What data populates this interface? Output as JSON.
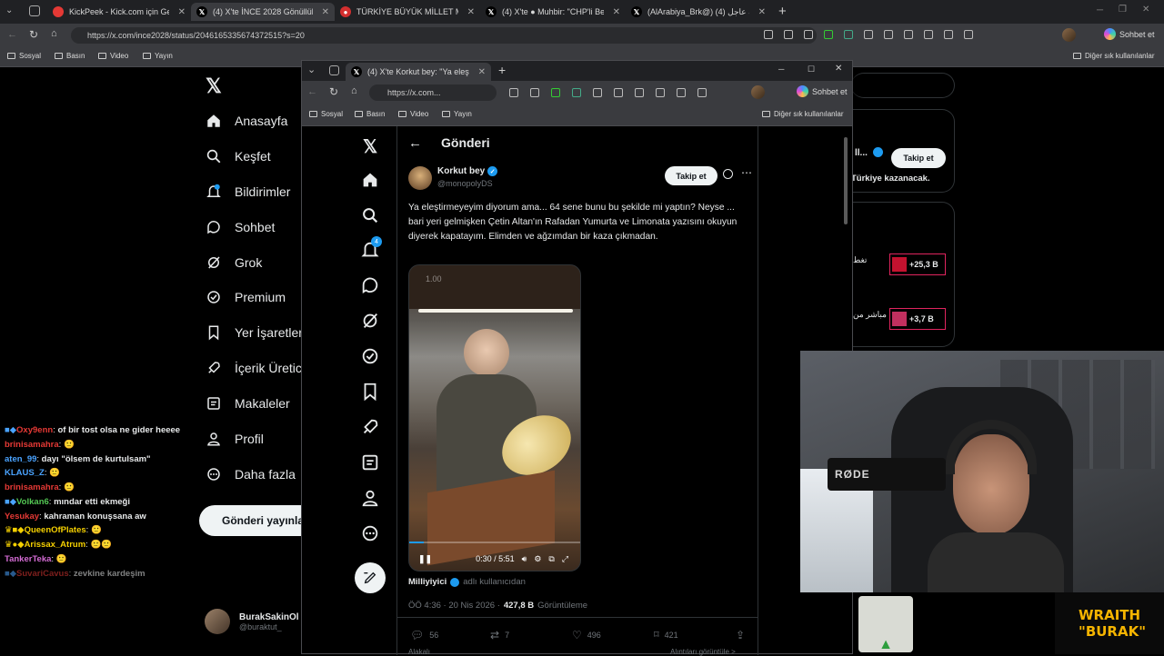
{
  "tabs": [
    {
      "label": "KickPeek - Kick.com için Gerçek Za",
      "fav_color": "#e53935"
    },
    {
      "label": "(4) X'te İNCE 2028 Gönüllüleri: \"Al",
      "fav_color": "#000000"
    },
    {
      "label": "TÜRKİYE BÜYÜK MİLLET MECLİSİ",
      "fav_color": "#d32f2f"
    },
    {
      "label": "(4) X'te ● Muhbir: \"CHP'li Belediy",
      "fav_color": "#000000"
    },
    {
      "label": "(AlArabiya_Brk@) العربية عاجل (4)",
      "fav_color": "#000000"
    }
  ],
  "back_browser": {
    "url": "https://x.com/ince2028/status/2046165335674372515?s=20",
    "profile_button": "Sohbet et",
    "bookmarks": [
      "Sosyal",
      "Basın",
      "Video",
      "Yayın"
    ],
    "other_bookmarks": "Diğer sık kullanılanlar"
  },
  "back_nav": [
    {
      "label": "Anasayfa",
      "icon": "home-icon"
    },
    {
      "label": "Keşfet",
      "icon": "search-icon"
    },
    {
      "label": "Bildirimler",
      "icon": "bell-icon"
    },
    {
      "label": "Sohbet",
      "icon": "chat-icon"
    },
    {
      "label": "Grok",
      "icon": "grok-icon"
    },
    {
      "label": "Premium",
      "icon": "premium-icon"
    },
    {
      "label": "Yer İşaretleri",
      "icon": "bookmark-icon"
    },
    {
      "label": "İçerik Üretici",
      "icon": "rocket-icon"
    },
    {
      "label": "Makaleler",
      "icon": "article-icon"
    },
    {
      "label": "Profil",
      "icon": "person-icon"
    },
    {
      "label": "Daha fazla",
      "icon": "more-icon"
    }
  ],
  "back_post_button": "Gönderi yayınla",
  "back_notification_badge": "4",
  "back_profile": {
    "name": "BurakSakinOl",
    "handle": "@buraktut_"
  },
  "back_right": {
    "follow_label": "Takip et",
    "name_fragment": "ll...",
    "text": "Türkiye kazanacak.",
    "trend1_value": "+25,3 B",
    "trend1_text": "تغط",
    "trend2_value": "+3,7 B",
    "trend2_text": "مباشر من"
  },
  "chat": [
    {
      "name": "Oxy9enn",
      "name_color": "#e53935",
      "msg": "of bir tost olsa ne gider heeee"
    },
    {
      "name": "brinisamahra",
      "name_color": "#e53935",
      "msg": "🙂"
    },
    {
      "name": "aten_99",
      "name_color": "#4aa3ff",
      "msg": "dayı \"ölsem de kurtulsam\""
    },
    {
      "name": "KLAUS_Z",
      "name_color": "#4aa3ff",
      "msg": "🙂"
    },
    {
      "name": "brinisamahra",
      "name_color": "#e53935",
      "msg": "🙂"
    },
    {
      "name": "Volkan6",
      "name_color": "#53c653",
      "msg": "mındar etti ekmeği"
    },
    {
      "name": "Yesukay",
      "name_color": "#e53935",
      "msg": "kahraman konuşsana aw"
    },
    {
      "name": "QueenOfPlates",
      "name_color": "#f5d000",
      "msg": "🙂"
    },
    {
      "name": "Arissax_Atrum",
      "name_color": "#f5d000",
      "msg": "🙂🙂"
    },
    {
      "name": "TankerTeka",
      "name_color": "#d36bd3",
      "msg": "🙂"
    },
    {
      "name": "SuvariCavus",
      "name_color": "#e53935",
      "msg": "zevkine kardeşim"
    }
  ],
  "front_browser": {
    "tab_label": "(4) X'te Korkut bey: \"Ya eleştir",
    "url": "https://x.com...",
    "profile_button": "Sohbet et",
    "bookmarks": [
      "Sosyal",
      "Basın",
      "Video",
      "Yayın"
    ],
    "other_bookmarks": "Diğer sık kullanılanlar",
    "notification_badge": "4"
  },
  "post": {
    "header_title": "Gönderi",
    "author_name": "Korkut bey",
    "author_handle": "@monopolyDS",
    "follow_label": "Takip et",
    "text": "Ya eleştirmeyeyim diyorum ama... 64 sene bunu bu şekilde mi yaptın? Neyse ... bari yeri gelmişken Çetin Altan'ın Rafadan Yumurta ve Limonata yazısını okuyun diyerek kapatayım. Elimden ve ağzımdan bir kaza çıkmadan.",
    "video_overlay": "1.00",
    "video_time": "0:30 / 5:51",
    "video_progress": 0.086,
    "source_name": "Milliyiyici",
    "source_suffix": "adlı kullanıcıdan",
    "timestamp": "ÖÖ 4:36 · 20 Nis 2026 ·",
    "views": "427,8 B",
    "views_label": "Görüntüleme",
    "replies": "56",
    "reposts": "7",
    "likes": "496",
    "bookmarks": "421",
    "footer_left": "Alakalı",
    "footer_right": "Alıntıları görüntüle >"
  },
  "webcam": {
    "mic_brand": "RØDE"
  },
  "overlay_brand": {
    "line1": "WRAITH",
    "line2": "\"BURAK\""
  }
}
